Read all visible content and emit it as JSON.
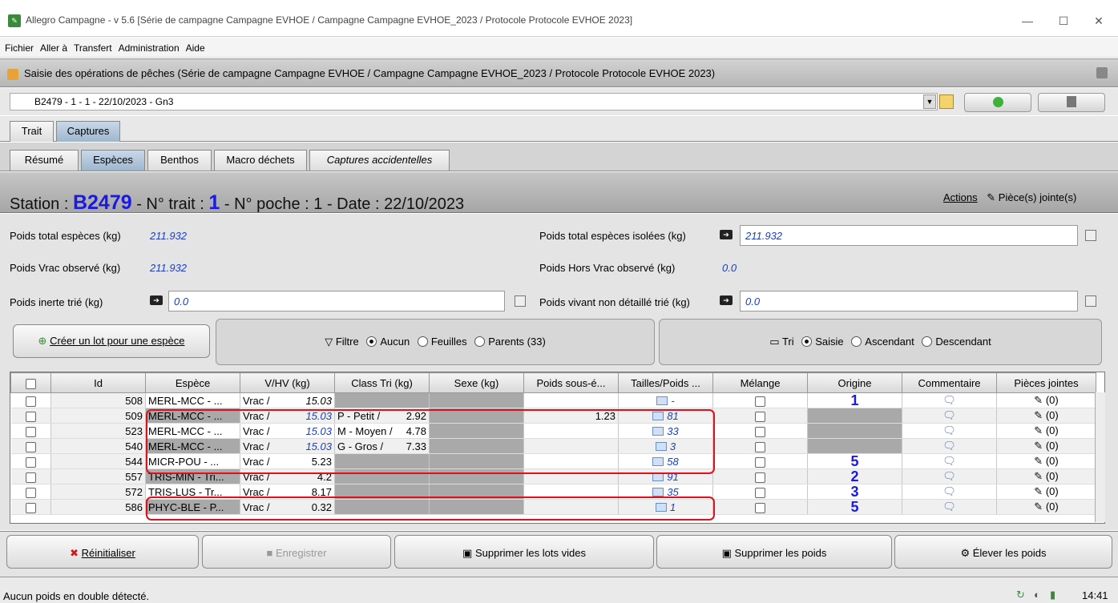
{
  "window": {
    "title": "Allegro Campagne - v 5.6 [Série de campagne Campagne EVHOE / Campagne Campagne EVHOE_2023 / Protocole Protocole EVHOE 2023]",
    "minimize": "—",
    "maximize": "☐",
    "close": "✕"
  },
  "menu": [
    "Fichier",
    "Aller à",
    "Transfert",
    "Administration",
    "Aide"
  ],
  "subtitle": "Saisie des opérations de pêches (Série de campagne Campagne EVHOE / Campagne Campagne EVHOE_2023 / Protocole Protocole EVHOE 2023)",
  "selector": {
    "value": "B2479 - 1 - 1 - 22/10/2023 - Gn3"
  },
  "tabs_main": [
    "Trait",
    "Captures"
  ],
  "tabs_sub": [
    "Résumé",
    "Espèces",
    "Benthos",
    "Macro déchets",
    "Captures accidentelles"
  ],
  "header": {
    "station_label": "Station :",
    "station": "B2479",
    "trait_label": "- N° trait :",
    "trait": "1",
    "rest": "- N° poche : 1 - Date : 22/10/2023",
    "actions": "Actions",
    "attachments": "Pièce(s) jointe(s)"
  },
  "fields": {
    "poids_total_label": "Poids total espèces (kg)",
    "poids_total_value": "211.932",
    "poids_isolees_label": "Poids total espèces isolées (kg)",
    "poids_isolees_value": "211.932",
    "poids_vrac_label": "Poids Vrac observé (kg)",
    "poids_vrac_value": "211.932",
    "poids_hors_vrac_label": "Poids Hors Vrac observé (kg)",
    "poids_hors_vrac_value": "0.0",
    "poids_inerte_label": "Poids inerte trié (kg)",
    "poids_inerte_value": "0.0",
    "poids_vivant_label": "Poids vivant non détaillé trié (kg)",
    "poids_vivant_value": "0.0"
  },
  "toolbar": {
    "create_lot": "Créer un lot pour une espèce",
    "filter_label": "Filtre",
    "filter_options": [
      "Aucun",
      "Feuilles",
      "Parents (33)"
    ],
    "sort_label": "Tri",
    "sort_options": [
      "Saisie",
      "Ascendant",
      "Descendant"
    ]
  },
  "table": {
    "columns": [
      "Id",
      "Espèce",
      "V/HV (kg)",
      "Class Tri (kg)",
      "Sexe (kg)",
      "Poids sous-é...",
      "Tailles/Poids ...",
      "Mélange",
      "Origine",
      "Commentaire",
      "Pièces jointes"
    ],
    "rows": [
      {
        "id": "508",
        "espece": "MERL-MCC - ...",
        "vhv": "Vrac /",
        "vhv_w": "15.03",
        "class": "",
        "class_w": "",
        "sous": "",
        "tailles": "-",
        "origine": "1",
        "pj": "(0)"
      },
      {
        "id": "509",
        "espece": "MERL-MCC - ...",
        "vhv": "Vrac /",
        "vhv_w": "15.03",
        "class": "P - Petit /",
        "class_w": "2.92",
        "sous": "1.23",
        "tailles": "81",
        "origine": "",
        "pj": "(0)"
      },
      {
        "id": "523",
        "espece": "MERL-MCC - ...",
        "vhv": "Vrac /",
        "vhv_w": "15.03",
        "class": "M - Moyen /",
        "class_w": "4.78",
        "sous": "",
        "tailles": "33",
        "origine": "",
        "pj": "(0)"
      },
      {
        "id": "540",
        "espece": "MERL-MCC - ...",
        "vhv": "Vrac /",
        "vhv_w": "15.03",
        "class": "G - Gros /",
        "class_w": "7.33",
        "sous": "",
        "tailles": "3",
        "origine": "",
        "pj": "(0)"
      },
      {
        "id": "544",
        "espece": "MICR-POU - ...",
        "vhv": "Vrac /",
        "vhv_w": "5.23",
        "class": "",
        "class_w": "",
        "sous": "",
        "tailles": "58",
        "origine": "5",
        "pj": "(0)"
      },
      {
        "id": "557",
        "espece": "TRIS-MIN - Tri...",
        "vhv": "Vrac /",
        "vhv_w": "4.2",
        "class": "",
        "class_w": "",
        "sous": "",
        "tailles": "91",
        "origine": "2",
        "pj": "(0)"
      },
      {
        "id": "572",
        "espece": "TRIS-LUS - Tr...",
        "vhv": "Vrac /",
        "vhv_w": "8.17",
        "class": "",
        "class_w": "",
        "sous": "",
        "tailles": "35",
        "origine": "3",
        "pj": "(0)"
      },
      {
        "id": "586",
        "espece": "PHYC-BLE - P...",
        "vhv": "Vrac /",
        "vhv_w": "0.32",
        "class": "",
        "class_w": "",
        "sous": "",
        "tailles": "1",
        "origine": "5",
        "pj": "(0)"
      }
    ]
  },
  "buttons": {
    "reset": "Réinitialiser",
    "save": "Enregistrer",
    "delete_empty": "Supprimer les lots vides",
    "delete_weights": "Supprimer les poids",
    "raise_weights": "Élever les poids"
  },
  "status": {
    "message": "Aucun poids en double détecté.",
    "time": "14:41"
  },
  "colors": {
    "accent_blue": "#1a1ae0",
    "highlight_red": "#e0101a",
    "value_blue": "#1c3fc0"
  }
}
